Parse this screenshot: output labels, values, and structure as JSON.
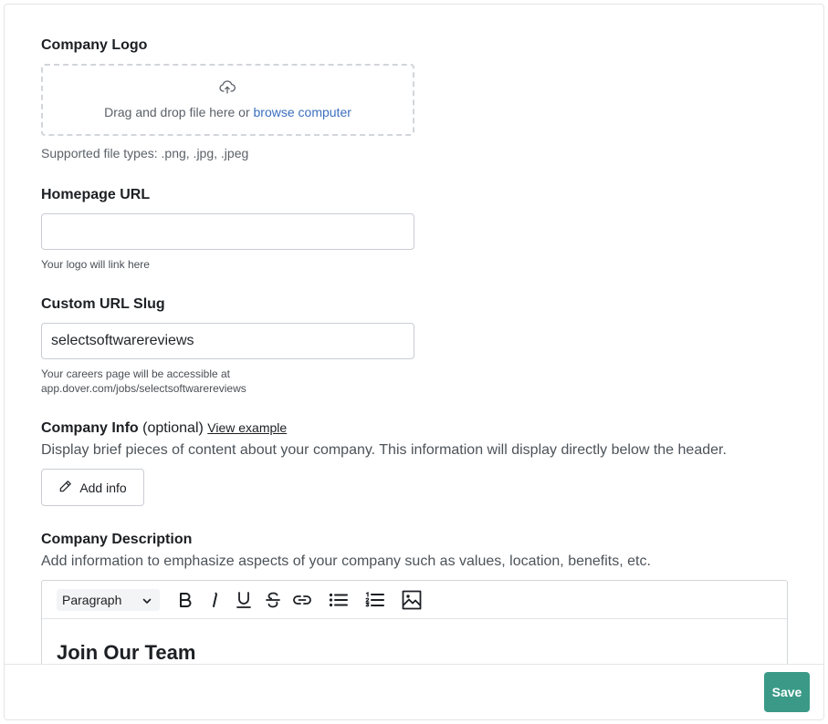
{
  "logo": {
    "label": "Company Logo",
    "dropzone_text": "Drag and drop file here or ",
    "browse_link": "browse computer",
    "supported": "Supported file types: .png, .jpg, .jpeg"
  },
  "homepage": {
    "label": "Homepage URL",
    "value": "",
    "helper": "Your logo will link here"
  },
  "slug": {
    "label": "Custom URL Slug",
    "value": "selectsoftwarereviews",
    "helper_line1": "Your careers page will be accessible at",
    "helper_line2": "app.dover.com/jobs/selectsoftwarereviews"
  },
  "company_info": {
    "label": "Company Info",
    "optional": " (optional)",
    "view_example": "View example",
    "description": "Display brief pieces of content about your company. This information will display directly below the header.",
    "add_button": "Add info"
  },
  "company_description": {
    "label": "Company Description",
    "description": "Add information to emphasize aspects of your company such as values, location, benefits, etc.",
    "toolbar": {
      "paragraph_select": "Paragraph",
      "icons": [
        "bold-icon",
        "italic-icon",
        "underline-icon",
        "strikethrough-icon",
        "link-icon",
        "bullet-list-icon",
        "numbered-list-icon",
        "image-icon"
      ]
    },
    "content_heading": "Join Our Team"
  },
  "footer": {
    "save": "Save"
  },
  "colors": {
    "accent": "#3a9a87",
    "link": "#3b6fbf"
  }
}
